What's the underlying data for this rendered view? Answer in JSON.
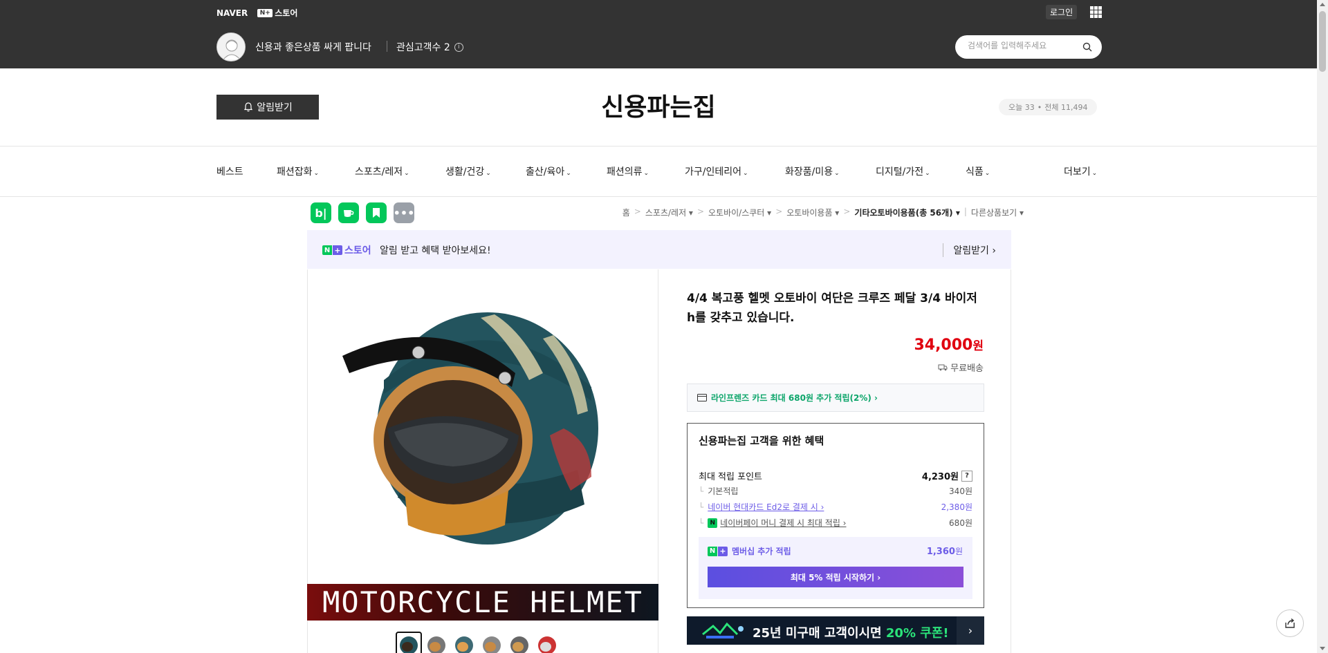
{
  "topbar": {
    "naver_logo": "NAVER",
    "store_badge": "N+",
    "store_label": "스토어",
    "login": "로그인",
    "apps_icon": "grid-icon"
  },
  "seller": {
    "tagline": "신용과 좋은상품 싸게 팝니다",
    "fav_label": "관심고객수 2",
    "info_icon": "ⓘ"
  },
  "search": {
    "placeholder": "검색어를 입력해주세요"
  },
  "store": {
    "alarm_button": "알림받기",
    "title": "신용파는집",
    "visitors_today": "오늘 33",
    "visitors_dot": "•",
    "visitors_total": "전체 11,494"
  },
  "nav": {
    "items": [
      {
        "label": "베스트",
        "chev": ""
      },
      {
        "label": "패션잡화",
        "chev": "⌄"
      },
      {
        "label": "스포츠/레저",
        "chev": "⌄"
      },
      {
        "label": "생활/건강",
        "chev": "⌄"
      },
      {
        "label": "출산/육아",
        "chev": "⌄"
      },
      {
        "label": "패션의류",
        "chev": "⌄"
      },
      {
        "label": "가구/인테리어",
        "chev": "⌄"
      },
      {
        "label": "화장품/미용",
        "chev": "⌄"
      },
      {
        "label": "디지털/가전",
        "chev": "⌄"
      },
      {
        "label": "식품",
        "chev": "⌄"
      }
    ],
    "more": "더보기"
  },
  "share": {
    "blog": "b|",
    "cafe": "☕",
    "bookmark": "🔖",
    "more": "•••"
  },
  "breadcrumb": {
    "home": "홈",
    "c1": "스포츠/레저 ▾",
    "c2": "오토바이/스쿠터 ▾",
    "c3": "오토바이용품 ▾",
    "c4": "기타오토바이용품(총 56개) ▾",
    "other": "다른상품보기 ▾",
    "sep": ">"
  },
  "promo": {
    "store_label": "스토어",
    "message": "알림 받고 혜택 받아보세요!",
    "link": "알림받기 ›"
  },
  "product": {
    "banner_text": "MOTORCYCLE HELMET",
    "title": "4/4 복고풍 헬멧 오토바이 여단은 크루즈 페달 3/4 바이저 h를 갖추고 있습니다.",
    "price": "34,000",
    "price_unit": "원",
    "shipping": "무료배송",
    "card_benefit": "라인프렌즈 카드 최대 680원 추가 적립(2%) ›"
  },
  "benefit": {
    "title": "신용파는집 고객을 위한 혜택",
    "max_label": "최대 적립 포인트",
    "max_value": "4,230원",
    "qmark": "?",
    "tree": "└",
    "basic_label": "기본적립",
    "basic_value": "340원",
    "card_label": "네이버 현대카드 Ed2로 결제 시 ›",
    "card_value": "2,380원",
    "npay_badge": "N",
    "npay_label": "네이버페이 머니 결제 시 최대 적립 ›",
    "npay_value": "680원",
    "member_label": "멤버십 추가 적립",
    "member_value": "1,360",
    "member_unit": "원",
    "member_button": "최대 5% 적립 시작하기 ›"
  },
  "coupon": {
    "text_prefix": "25년 미구매 고객이시면 ",
    "text_highlight": "20% 쿠폰!",
    "arrow": "›"
  },
  "colors": {
    "topbar": "#333333",
    "price_red": "#e0000f",
    "naver_green": "#03c75a",
    "plus_purple": "#6c5ce7",
    "card_green": "#0ca56a"
  }
}
